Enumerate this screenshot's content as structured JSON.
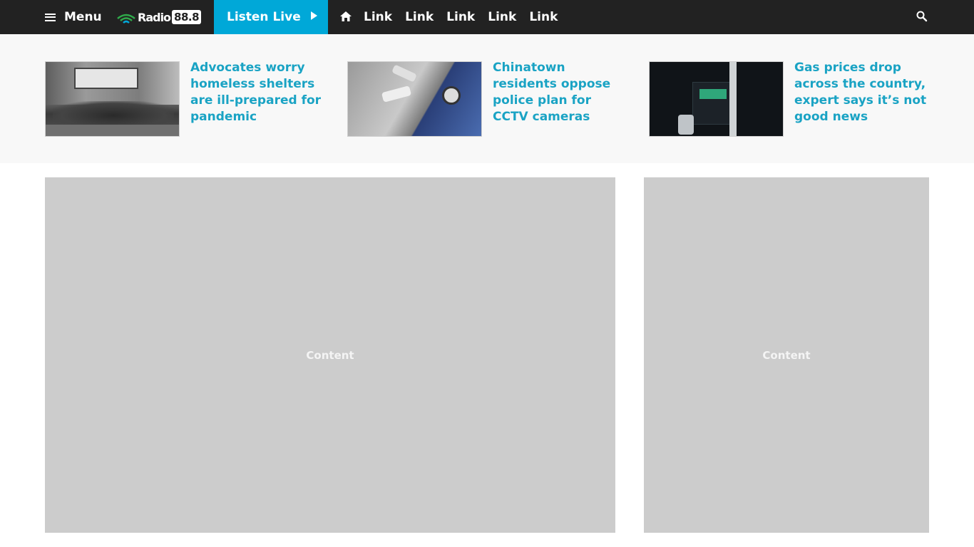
{
  "nav": {
    "menu_label": "Menu",
    "logo": {
      "word": "Radio",
      "number": "88.8"
    },
    "listen_live_label": "Listen Live",
    "links": [
      "Link",
      "Link",
      "Link",
      "Link",
      "Link"
    ],
    "background": "#222222",
    "accent": "#00a8d8"
  },
  "headlines": [
    {
      "title": "Advocates worry homeless shelters are ill-prepared for pandemic"
    },
    {
      "title": "Chinatown residents oppose police plan for CCTV cameras"
    },
    {
      "title": "Gas prices drop across the country, expert says it’s not good news"
    }
  ],
  "headline_color": "#1aa3c4",
  "main": {
    "primary_content_label": "Content",
    "sidebar_content_label": "Content"
  }
}
